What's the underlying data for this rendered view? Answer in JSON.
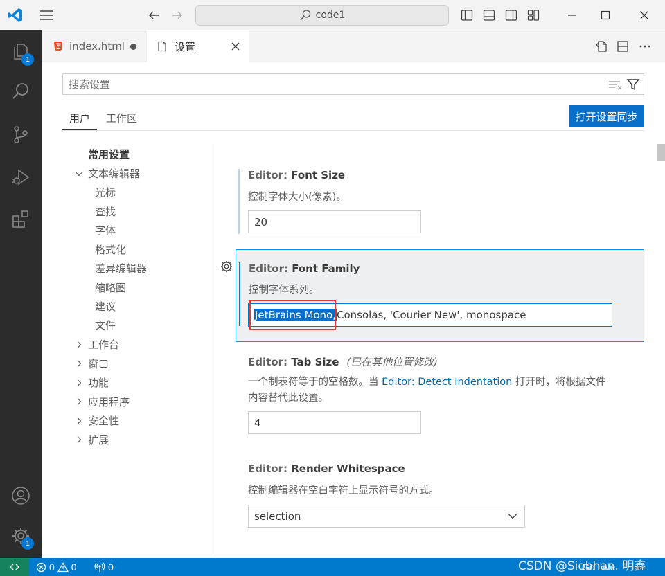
{
  "titlebar": {
    "command_center_text": "code1",
    "icons": [
      "vscode-logo",
      "menu",
      "arrow-left",
      "arrow-right",
      "search",
      "toggle-primary-sidebar",
      "toggle-panel",
      "toggle-secondary-sidebar",
      "customize-layout",
      "minimize",
      "maximize",
      "close"
    ]
  },
  "activity_bar": {
    "explorer_badge": "1",
    "manage_badge": "1",
    "items": [
      "explorer",
      "search",
      "source-control",
      "run-and-debug",
      "extensions",
      "accounts",
      "manage"
    ]
  },
  "tabs": [
    {
      "label": "index.html",
      "icon": "html5-icon",
      "dirty": true
    },
    {
      "label": "设置",
      "icon": "file-icon",
      "active": true
    }
  ],
  "settings_editor": {
    "search_placeholder": "搜索设置",
    "scopes": {
      "user": "用户",
      "workspace": "工作区"
    },
    "sync_button": "打开设置同步",
    "toc": {
      "common": "常用设置",
      "text_editor": "文本编辑器",
      "text_editor_children": [
        "光标",
        "查找",
        "字体",
        "格式化",
        "差异编辑器",
        "缩略图",
        "建议",
        "文件"
      ],
      "collapsed_groups": [
        "工作台",
        "窗口",
        "功能",
        "应用程序",
        "安全性",
        "扩展"
      ]
    },
    "settings": {
      "font_size": {
        "prefix": "Editor: ",
        "name": "Font Size",
        "desc": "控制字体大小(像素)。",
        "value": "20"
      },
      "font_family": {
        "prefix": "Editor: ",
        "name": "Font Family",
        "desc": "控制字体系列。",
        "value_selected": "JetBrains Mono,",
        "value_rest": "Consolas, 'Courier New', monospace"
      },
      "tab_size": {
        "prefix": "Editor: ",
        "name": "Tab Size",
        "modified_note": "(已在其他位置修改)",
        "desc_1": "一个制表符等于的空格数。当 ",
        "desc_link": "Editor: Detect Indentation",
        "desc_2": " 打开时，将根据文件",
        "desc_line2": "内容替代此设置。",
        "value": "4"
      },
      "render_whitespace": {
        "prefix": "Editor: ",
        "name": "Render Whitespace",
        "desc": "控制编辑器在空白字符上显示符号的方式。",
        "value": "selection"
      }
    }
  },
  "status_bar": {
    "errors": "0",
    "warnings": "0",
    "ports": "0",
    "go_live": "Go Live"
  },
  "watermark": "CSDN @Siobhan. 明鑫",
  "colors": {
    "accent": "#0078d4",
    "status_bar": "#007acc",
    "activity_bar": "#2c2c2c",
    "highlight_box": "#e53935"
  }
}
